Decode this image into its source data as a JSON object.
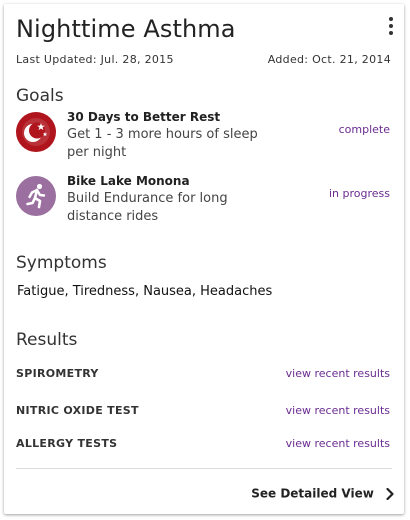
{
  "card": {
    "title": "Nighttime Asthma",
    "last_updated": "Last Updated: Jul. 28, 2015",
    "added": "Added: Oct. 21, 2014",
    "menu_icon": "more-vert-icon"
  },
  "goals": {
    "heading": "Goals",
    "items": [
      {
        "name": "30 Days to Better Rest",
        "description": "Get 1 - 3 more hours of sleep per night",
        "status": "complete",
        "icon": "moon-stars-icon",
        "icon_color": "#b0151e"
      },
      {
        "name": "Bike Lake Monona",
        "description": "Build Endurance for long distance rides",
        "status": "in progress",
        "icon": "runner-icon",
        "icon_color": "#9b6fa0"
      }
    ]
  },
  "symptoms": {
    "heading": "Symptoms",
    "text": "Fatigue, Tiredness, Nausea, Headaches"
  },
  "results": {
    "heading": "Results",
    "items": [
      {
        "name": "SPIROMETRY",
        "link": "view recent results"
      },
      {
        "name": "NITRIC OXIDE TEST",
        "link": "view recent results"
      },
      {
        "name": "ALLERGY TESTS",
        "link": "view recent results"
      }
    ]
  },
  "footer": {
    "detail_label": "See Detailed View",
    "chevron_icon": "chevron-right-icon"
  },
  "colors": {
    "accent_link": "#6a2c91",
    "goal1_icon": "#b0151e",
    "goal2_icon": "#9b6fa0"
  }
}
